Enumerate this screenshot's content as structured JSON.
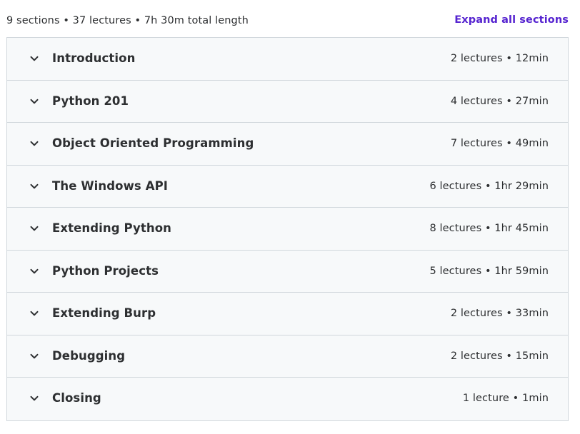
{
  "summary": {
    "text": "9 sections • 37 lectures • 7h 30m total length",
    "expand_label": "Expand all sections"
  },
  "icons": {
    "section_toggle": "chevron-down-icon"
  },
  "colors": {
    "link": "#5624d0",
    "row_background": "#f7f9fa",
    "border": "#d1d7dc",
    "text": "#2d2f31"
  },
  "sections": [
    {
      "title": "Introduction",
      "meta": "2 lectures • 12min"
    },
    {
      "title": "Python 201",
      "meta": "4 lectures • 27min"
    },
    {
      "title": "Object Oriented Programming",
      "meta": "7 lectures • 49min"
    },
    {
      "title": "The Windows API",
      "meta": "6 lectures • 1hr 29min"
    },
    {
      "title": "Extending Python",
      "meta": "8 lectures • 1hr 45min"
    },
    {
      "title": "Python Projects",
      "meta": "5 lectures • 1hr 59min"
    },
    {
      "title": "Extending Burp",
      "meta": "2 lectures • 33min"
    },
    {
      "title": "Debugging",
      "meta": "2 lectures • 15min"
    },
    {
      "title": "Closing",
      "meta": "1 lecture • 1min"
    }
  ]
}
